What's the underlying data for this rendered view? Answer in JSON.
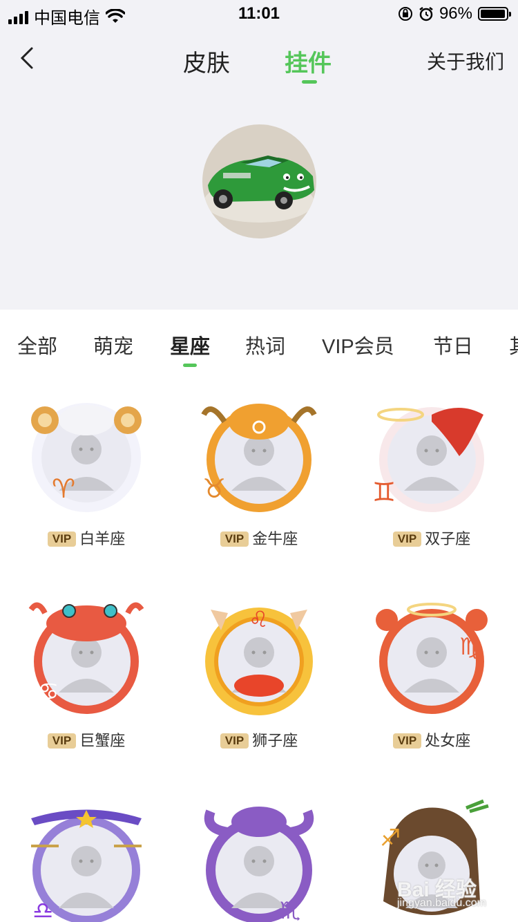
{
  "status_bar": {
    "carrier": "中国电信",
    "time": "11:01",
    "battery_text": "96%",
    "battery_level": 0.96
  },
  "header": {
    "tab_skin": "皮肤",
    "tab_pendant": "挂件",
    "about": "关于我们",
    "accent_color": "#55c65a"
  },
  "categories": [
    "全部",
    "萌宠",
    "星座",
    "热词",
    "VIP会员",
    "节日",
    "其"
  ],
  "badge": "VIP",
  "pendants": [
    {
      "name": "白羊座"
    },
    {
      "name": "金牛座"
    },
    {
      "name": "双子座"
    },
    {
      "name": "巨蟹座"
    },
    {
      "name": "狮子座"
    },
    {
      "name": "处女座"
    },
    {
      "name": ""
    },
    {
      "name": ""
    },
    {
      "name": ""
    }
  ],
  "watermark": {
    "text": "Bai 经验",
    "sub": "jingyan.baidu.com"
  }
}
